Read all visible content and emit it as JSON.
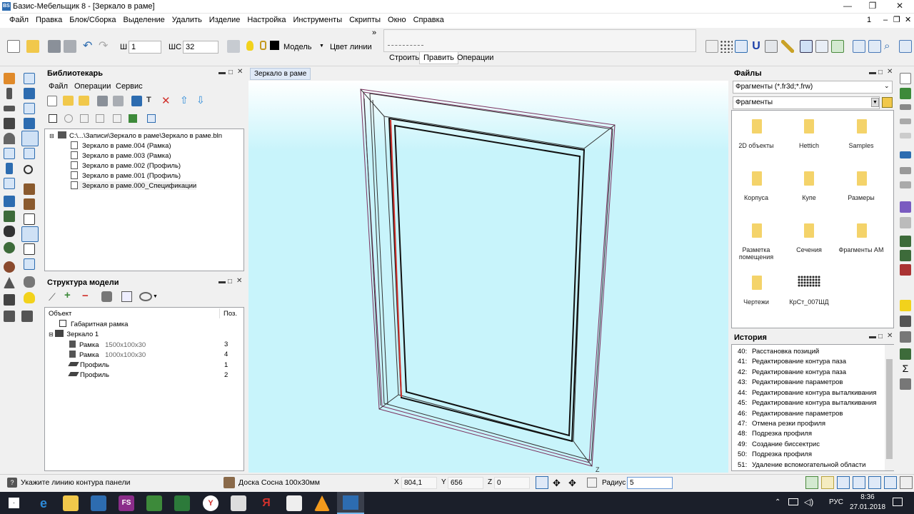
{
  "window": {
    "title": "Базис-Мебельщик 8 - [Зеркало в раме]",
    "controls": [
      "—",
      "❐",
      "✕"
    ]
  },
  "menu": [
    "Файл",
    "Правка",
    "Блок/Сборка",
    "Выделение",
    "Удалить",
    "Изделие",
    "Настройка",
    "Инструменты",
    "Скрипты",
    "Окно",
    "Справка"
  ],
  "menu_right": {
    "index": "1",
    "controls": [
      "–",
      "❐",
      "✕"
    ]
  },
  "toolbar": {
    "sh_label": "Ш",
    "sh_value": "1",
    "shc_label": "ШС",
    "shc_value": "32",
    "model_label": "Модель",
    "line_color_label": "Цвет линии",
    "overflow": "»"
  },
  "mode_tabs": [
    "Строить",
    "Править",
    "Операции"
  ],
  "librarian": {
    "title": "Библиотекарь",
    "menu": [
      "Файл",
      "Операции",
      "Сервис"
    ],
    "root": "C:\\...\\Записи\\Зеркало в раме\\Зеркало в раме.bln",
    "items": [
      "Зеркало в раме.004 (Рамка)",
      "Зеркало в раме.003 (Рамка)",
      "Зеркало в раме.002 (Профиль)",
      "Зеркало в раме.001 (Профиль)",
      "Зеркало в раме.000_Спецификации"
    ]
  },
  "structure": {
    "title": "Структура модели",
    "col_object": "Объект",
    "col_pos": "Поз.",
    "rows": [
      {
        "name": "Габаритная рамка",
        "size": "",
        "pos": ""
      },
      {
        "name": "Зеркало 1",
        "size": "",
        "pos": ""
      },
      {
        "name": "Рамка",
        "size": "1500x100x30",
        "pos": "3"
      },
      {
        "name": "Рамка",
        "size": "1000x100x30",
        "pos": "4"
      },
      {
        "name": "Профиль",
        "size": "",
        "pos": "1"
      },
      {
        "name": "Профиль",
        "size": "",
        "pos": "2"
      }
    ]
  },
  "viewport": {
    "tab": "Зеркало в раме",
    "axis_label": "Z"
  },
  "files": {
    "title": "Файлы",
    "filter": "Фрагменты (*.fr3d;*.frw)",
    "folder": "Фрагменты",
    "items": [
      "2D объекты",
      "Hettich",
      "Samples",
      "Корпуса",
      "Купе",
      "Размеры",
      "Разметка помещения",
      "Сечения",
      "Фрагменты АМ",
      "Чертежи",
      "КрСт_007ШД"
    ]
  },
  "history": {
    "title": "История",
    "items": [
      {
        "n": "40:",
        "t": "Расстановка позиций"
      },
      {
        "n": "41:",
        "t": "Редактирование контура паза"
      },
      {
        "n": "42:",
        "t": "Редактирование контура паза"
      },
      {
        "n": "43:",
        "t": "Редактирование параметров"
      },
      {
        "n": "44:",
        "t": "Редактирование контура выталкивания"
      },
      {
        "n": "45:",
        "t": "Редактирование контура выталкивания"
      },
      {
        "n": "46:",
        "t": "Редактирование параметров"
      },
      {
        "n": "47:",
        "t": "Отмена резки профиля"
      },
      {
        "n": "48:",
        "t": "Подрезка профиля"
      },
      {
        "n": "49:",
        "t": "Создание биссектрис"
      },
      {
        "n": "50:",
        "t": "Подрезка профиля"
      },
      {
        "n": "51:",
        "t": "Удаление вспомогательной области"
      }
    ]
  },
  "status": {
    "hint": "Укажите линию контура панели",
    "material": "Доска Сосна 100х30мм",
    "x_label": "X",
    "x": "804,1",
    "y_label": "Y",
    "y": "656",
    "z_label": "Z",
    "z": "0",
    "radius_label": "Радиус",
    "radius": "5"
  },
  "taskbar": {
    "lang": "РУС",
    "time": "8:36",
    "date": "27.01.2018",
    "app_fs": "FS"
  },
  "colors": {
    "viewport_top": "#ffffff",
    "viewport_bottom": "#c8f4fb",
    "accent": "#2d6cb0",
    "frame_line": "#7a2f5d",
    "frame_red": "#d1312c"
  }
}
